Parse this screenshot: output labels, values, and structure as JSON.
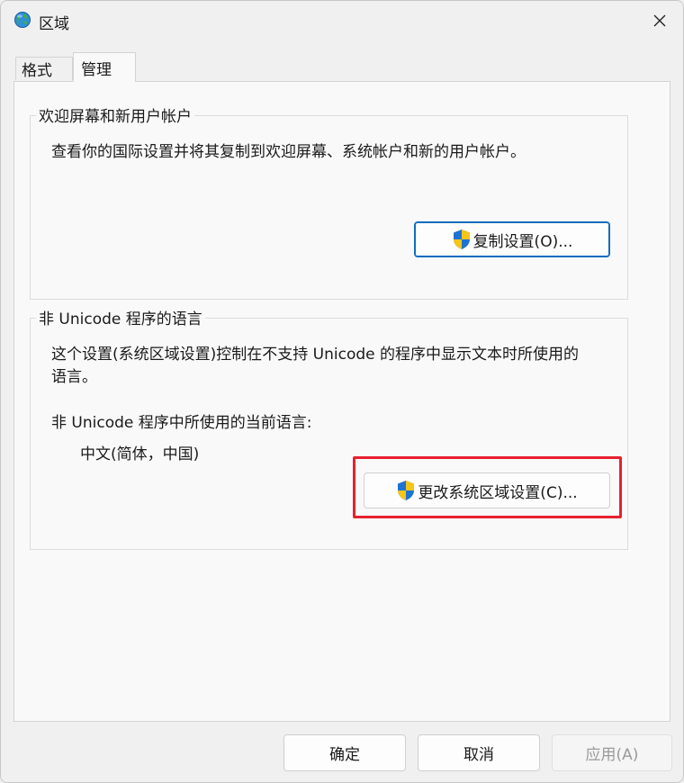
{
  "window": {
    "title": "区域"
  },
  "tabs": [
    {
      "label": "格式",
      "active": false
    },
    {
      "label": "管理",
      "active": true
    }
  ],
  "welcome_group": {
    "legend": "欢迎屏幕和新用户帐户",
    "description": "查看你的国际设置并将其复制到欢迎屏幕、系统帐户和新的用户帐户。",
    "button_label": "复制设置(O)..."
  },
  "unicode_group": {
    "legend": "非 Unicode 程序的语言",
    "description_line1": "这个设置(系统区域设置)控制在不支持 Unicode 的程序中显示文本时所使用的",
    "description_line2": "语言。",
    "current_label": "非 Unicode 程序中所使用的当前语言:",
    "current_value": "中文(简体，中国)",
    "button_label": "更改系统区域设置(C)..."
  },
  "footer": {
    "ok_label": "确定",
    "cancel_label": "取消",
    "apply_label": "应用(A)"
  },
  "colors": {
    "accent": "#0f6cbd",
    "highlight": "#e8202e",
    "shield_blue": "#1e73d2",
    "shield_yellow": "#f5c518"
  },
  "icons": [
    "globe-icon",
    "close-icon",
    "uac-shield-icon"
  ]
}
